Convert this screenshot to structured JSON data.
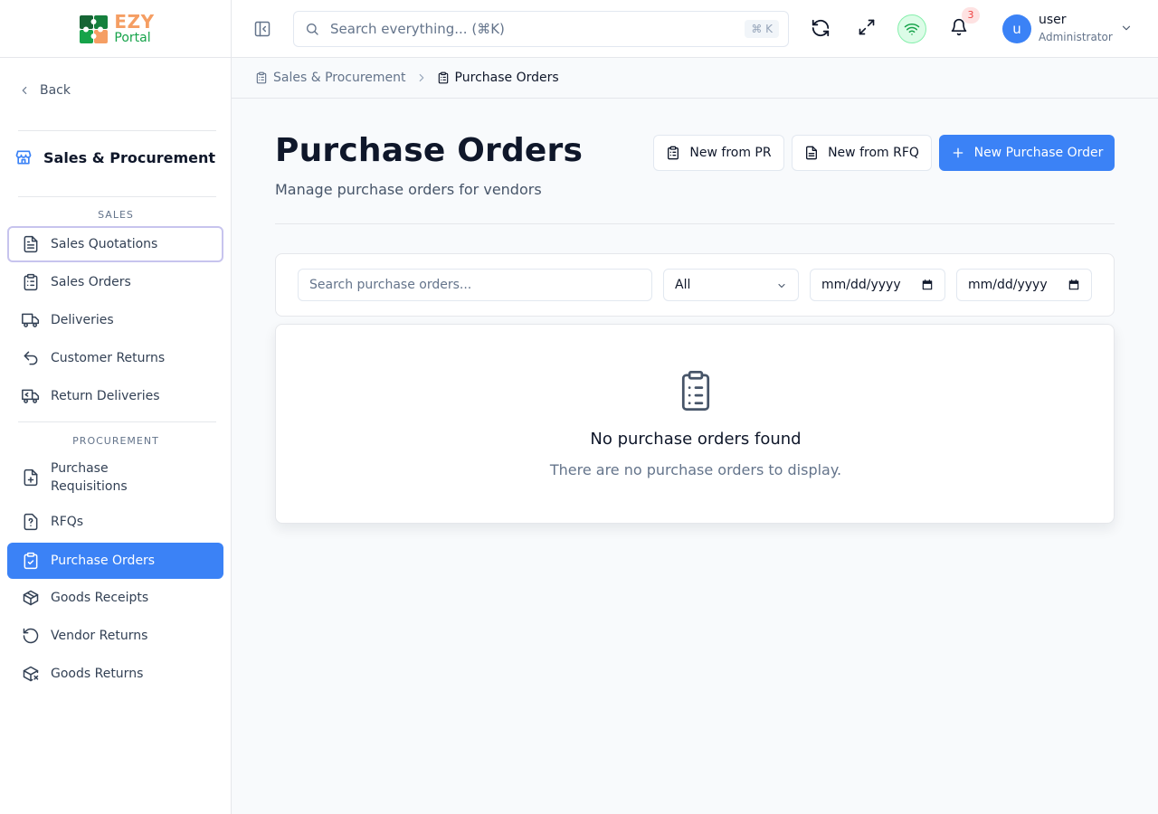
{
  "app": {
    "logo_primary": "EZY",
    "logo_secondary": "Portal"
  },
  "colors": {
    "primary": "#3b82f6",
    "sidebar_bg": "#ffffff",
    "page_bg": "#f8fafc",
    "logo_orange": "#f59e63",
    "logo_green": "#16a34a",
    "badge_red": "#ef4444"
  },
  "sidebar": {
    "back_label": "Back",
    "module_title": "Sales & Procurement",
    "module_icon": "store-icon",
    "sales_section": {
      "label": "SALES",
      "items": [
        {
          "label": "Sales Quotations",
          "icon": "file-text-icon",
          "state": "focused"
        },
        {
          "label": "Sales Orders",
          "icon": "clipboard-list-icon"
        },
        {
          "label": "Deliveries",
          "icon": "truck-icon"
        },
        {
          "label": "Customer Returns",
          "icon": "undo-icon"
        },
        {
          "label": "Return Deliveries",
          "icon": "truck-return-icon"
        }
      ]
    },
    "procurement_section": {
      "label": "PROCUREMENT",
      "items": [
        {
          "label": "Purchase Requisitions",
          "icon": "file-plus-icon"
        },
        {
          "label": "RFQs",
          "icon": "file-question-icon"
        },
        {
          "label": "Purchase Orders",
          "icon": "clipboard-check-icon",
          "state": "active"
        },
        {
          "label": "Goods Receipts",
          "icon": "package-check-icon"
        },
        {
          "label": "Vendor Returns",
          "icon": "rotate-ccw-icon"
        },
        {
          "label": "Goods Returns",
          "icon": "package-x-icon"
        }
      ]
    }
  },
  "header": {
    "search_placeholder": "Search everything... (⌘K)",
    "search_shortcut": "⌘ K",
    "notification_count": "3",
    "user": {
      "initial": "u",
      "name": "user",
      "role": "Administrator"
    }
  },
  "breadcrumb": {
    "items": [
      "Sales & Procurement",
      "Purchase Orders"
    ]
  },
  "page": {
    "title": "Purchase Orders",
    "subtitle": "Manage purchase orders for vendors",
    "actions": {
      "new_from_pr": "New from PR",
      "new_from_rfq": "New from RFQ",
      "new_po": "New Purchase Order"
    }
  },
  "filters": {
    "search_placeholder": "Search purchase orders...",
    "status_value": "All",
    "date_from_placeholder": "mm/dd/yyyy",
    "date_to_placeholder": "mm/dd/yyyy"
  },
  "empty_state": {
    "title": "No purchase orders found",
    "message": "There are no purchase orders to display."
  }
}
